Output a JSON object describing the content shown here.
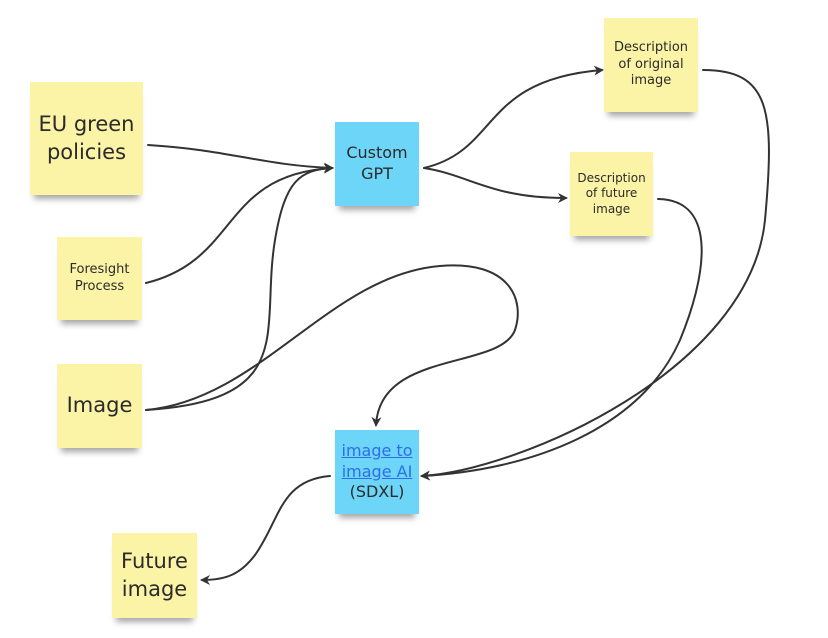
{
  "colors": {
    "note_yellow": "#fbf3a6",
    "note_blue": "#6dd5f7",
    "link": "#2f6ee8",
    "arrow": "#333333"
  },
  "notes": {
    "eu_green_policies": "EU green policies",
    "foresight_process": "Foresight Process",
    "image": "Image",
    "custom_gpt": "Custom GPT",
    "description_original": "Description of original image",
    "description_future": "Description of future image",
    "img2img": {
      "link_text": "image to image AI",
      "suffix": " (SDXL)"
    },
    "future_image": "Future image"
  },
  "edges": [
    {
      "from": "EU green policies",
      "to": "Custom GPT"
    },
    {
      "from": "Foresight Process",
      "to": "Custom GPT"
    },
    {
      "from": "Image",
      "to": "Custom GPT"
    },
    {
      "from": "Custom GPT",
      "to": "Description of original image"
    },
    {
      "from": "Custom GPT",
      "to": "Description of future image"
    },
    {
      "from": "Image",
      "to": "image to image AI (SDXL)"
    },
    {
      "from": "Description of original image",
      "to": "image to image AI (SDXL)"
    },
    {
      "from": "Description of future image",
      "to": "image to image AI (SDXL)"
    },
    {
      "from": "image to image AI (SDXL)",
      "to": "Future image"
    }
  ]
}
